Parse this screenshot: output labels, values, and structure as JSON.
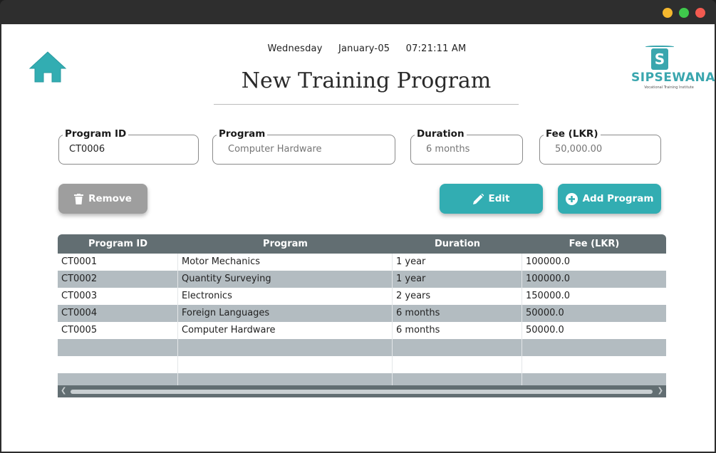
{
  "header": {
    "day": "Wednesday",
    "date": "January-05",
    "time": "07:21:11 AM",
    "title": "New Training Program"
  },
  "logo": {
    "mark": "S",
    "name": "SIPSEWANA",
    "tagline": "Vocational Training Institute"
  },
  "form": {
    "program_id": {
      "label": "Program ID",
      "value": "CT0006"
    },
    "program": {
      "label": "Program",
      "value": "",
      "placeholder": "Computer Hardware"
    },
    "duration": {
      "label": "Duration",
      "value": "",
      "placeholder": "6 months"
    },
    "fee": {
      "label": "Fee (LKR)",
      "value": "",
      "placeholder": "50,000.00"
    }
  },
  "buttons": {
    "remove": "Remove",
    "edit": "Edit",
    "add": "Add Program"
  },
  "table": {
    "headers": [
      "Program ID",
      "Program",
      "Duration",
      "Fee (LKR)"
    ],
    "rows": [
      [
        "CT0001",
        "Motor Mechanics",
        "1 year",
        "100000.0"
      ],
      [
        "CT0002",
        "Quantity Surveying",
        "1 year",
        "100000.0"
      ],
      [
        "CT0003",
        "Electronics",
        "2 years",
        "150000.0"
      ],
      [
        "CT0004",
        "Foreign Languages",
        "6 months",
        "50000.0"
      ],
      [
        "CT0005",
        "Computer Hardware",
        "6 months",
        "50000.0"
      ],
      [
        "",
        "",
        "",
        ""
      ],
      [
        "",
        "",
        "",
        ""
      ],
      [
        "",
        "",
        "",
        ""
      ]
    ]
  },
  "colors": {
    "accent": "#32adb2",
    "header_bg": "#626e72",
    "stripe": "#b3bcc1",
    "remove_bg": "#9e9e9e"
  },
  "icons": {
    "home": "home-icon",
    "remove": "trash-icon",
    "edit": "pencil-icon",
    "add": "plus-circle-icon"
  }
}
